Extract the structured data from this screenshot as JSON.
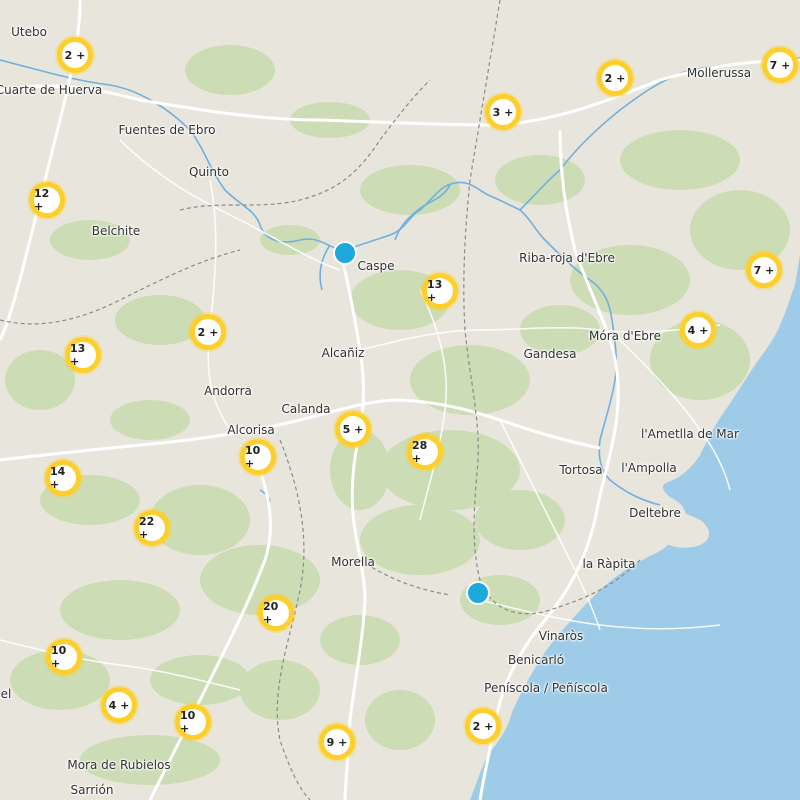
{
  "places": [
    {
      "id": "utebo",
      "name": "Utebo"
    },
    {
      "id": "cuarte",
      "name": "Cuarte de Huerva"
    },
    {
      "id": "fuentes",
      "name": "Fuentes de Ebro"
    },
    {
      "id": "quinto",
      "name": "Quinto"
    },
    {
      "id": "belchite",
      "name": "Belchite"
    },
    {
      "id": "caspe",
      "name": "Caspe"
    },
    {
      "id": "alcaniz",
      "name": "Alcañiz"
    },
    {
      "id": "andorra",
      "name": "Andorra"
    },
    {
      "id": "calanda",
      "name": "Calanda"
    },
    {
      "id": "alcorisa",
      "name": "Alcorisa"
    },
    {
      "id": "morella",
      "name": "Morella"
    },
    {
      "id": "mollerussa",
      "name": "Mollerussa"
    },
    {
      "id": "ribaroja",
      "name": "Riba-roja d'Ebre"
    },
    {
      "id": "gandesa",
      "name": "Gandesa"
    },
    {
      "id": "moradebre",
      "name": "Móra d'Ebre"
    },
    {
      "id": "ametlla",
      "name": "l'Ametlla de Mar"
    },
    {
      "id": "tortosa",
      "name": "Tortosa"
    },
    {
      "id": "ampolla",
      "name": "l'Ampolla"
    },
    {
      "id": "deltebre",
      "name": "Deltebre"
    },
    {
      "id": "rapita",
      "name": "la Ràpita"
    },
    {
      "id": "vinaros",
      "name": "Vinaròs"
    },
    {
      "id": "benicarlo",
      "name": "Benicarló"
    },
    {
      "id": "peniscola",
      "name": "Peníscola / Peñíscola"
    },
    {
      "id": "mora_rubielos",
      "name": "Mora de Rubielos"
    },
    {
      "id": "sarrion",
      "name": "Sarrión"
    },
    {
      "id": "teruel_edge",
      "name": "el"
    }
  ],
  "clusters": [
    {
      "id": "c1",
      "label": "2 +"
    },
    {
      "id": "c2",
      "label": "3 +"
    },
    {
      "id": "c3",
      "label": "2 +"
    },
    {
      "id": "c4",
      "label": "7 +"
    },
    {
      "id": "c5",
      "label": "12 +"
    },
    {
      "id": "c6",
      "label": "13 +"
    },
    {
      "id": "c7",
      "label": "7 +"
    },
    {
      "id": "c8",
      "label": "2 +"
    },
    {
      "id": "c9",
      "label": "13 +"
    },
    {
      "id": "c10",
      "label": "4 +"
    },
    {
      "id": "c11",
      "label": "5 +"
    },
    {
      "id": "c12",
      "label": "10 +"
    },
    {
      "id": "c13",
      "label": "28 +"
    },
    {
      "id": "c14",
      "label": "14 +"
    },
    {
      "id": "c15",
      "label": "22 +"
    },
    {
      "id": "c16",
      "label": "20 +"
    },
    {
      "id": "c17",
      "label": "10 +"
    },
    {
      "id": "c18",
      "label": "4 +"
    },
    {
      "id": "c19",
      "label": "10 +"
    },
    {
      "id": "c20",
      "label": "9 +"
    },
    {
      "id": "c21",
      "label": "2 +"
    }
  ],
  "pins": [
    {
      "id": "p1"
    },
    {
      "id": "p2"
    }
  ],
  "colors": {
    "land": "#e8e6dc",
    "sea": "#9ecbe8",
    "forest": "#c8dcb0",
    "river": "#6fb0e0",
    "road": "#ffffff",
    "border": "#8a8a8a",
    "cluster_ring": "#fccf2c",
    "pin": "#1ea9dd"
  }
}
